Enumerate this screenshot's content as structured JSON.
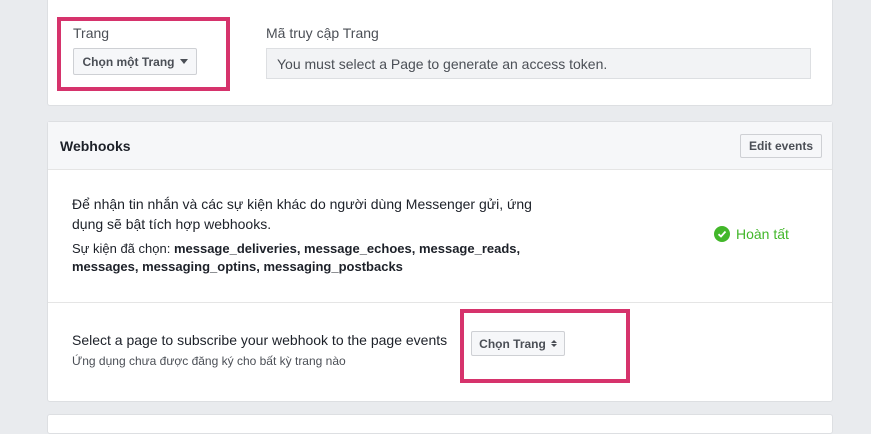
{
  "page_section": {
    "page_label": "Trang",
    "page_select_label": "Chọn một Trang",
    "token_label": "Mã truy cập Trang",
    "token_value": "You must select a Page to generate an access token."
  },
  "webhooks": {
    "title": "Webhooks",
    "edit_events_label": "Edit events",
    "description": "Để nhận tin nhắn và các sự kiện khác do người dùng Messenger gửi, ứng dụng sẽ bật tích hợp webhooks.",
    "events_prefix": "Sự kiện đã chọn:",
    "events_list": "message_deliveries, message_echoes, message_reads, messages, messaging_optins, messaging_postbacks",
    "status": "Hoàn tất",
    "subscribe_text": "Select a page to subscribe your webhook to the page events",
    "subscribe_note": "Ứng dụng chưa được đăng ký cho bất kỳ trang nào",
    "subscribe_select_label": "Chọn Trang"
  },
  "colors": {
    "highlight": "#d6336c",
    "success": "#42b72a",
    "background": "#e9ebee"
  },
  "icons": {
    "page_select": "caret-down-icon",
    "subscribe_select": "up-down-caret-icon",
    "status": "check-circle-icon"
  }
}
